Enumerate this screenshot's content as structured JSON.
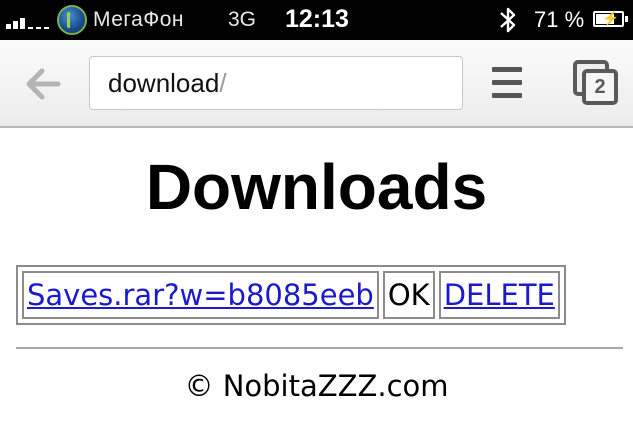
{
  "status_bar": {
    "carrier": "МегаФон",
    "network": "3G",
    "time": "12:13",
    "battery_percent_label": "71 %",
    "battery_level": 0.71,
    "icons": [
      "signal-strength-icon",
      "megafon-logo",
      "bluetooth-icon",
      "battery-charging-icon"
    ]
  },
  "toolbar": {
    "url_text": "download",
    "url_suffix": "/",
    "tab_count": "2",
    "icons": [
      "back-arrow-icon",
      "menu-icon",
      "tabs-icon"
    ]
  },
  "page": {
    "title": "Downloads",
    "downloads": [
      {
        "file_link": "Saves.rar?w=b8085eeb",
        "status": "OK",
        "delete_link": "DELETE"
      }
    ],
    "footer": "© NobitaZZZ.com"
  },
  "colors": {
    "link": "#1a1acc",
    "status_bar_bg": "#000000",
    "toolbar_bg": "#eeeeee"
  }
}
